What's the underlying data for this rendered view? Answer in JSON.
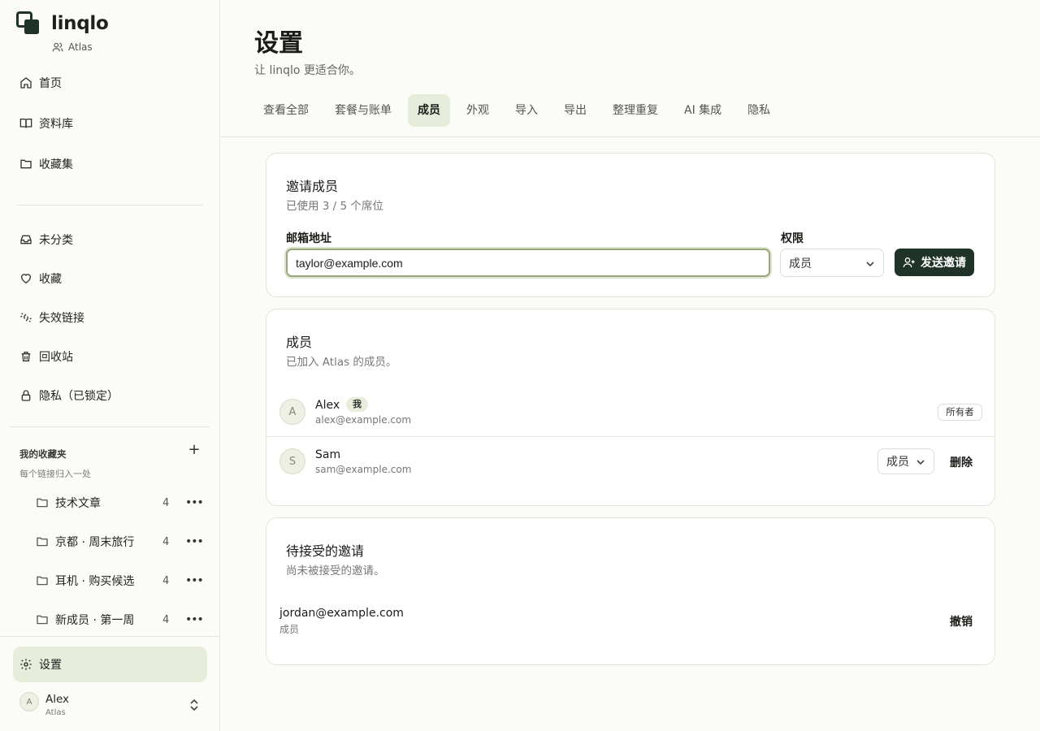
{
  "app": {
    "name": "linqlo",
    "workspace": "Atlas"
  },
  "sidebar": {
    "nav": [
      {
        "label": "首页",
        "icon": "home-icon"
      },
      {
        "label": "资料库",
        "icon": "book-icon"
      },
      {
        "label": "收藏集",
        "icon": "folder-icon"
      }
    ],
    "nav2": [
      {
        "label": "未分类",
        "icon": "inbox-icon"
      },
      {
        "label": "收藏",
        "icon": "heart-icon"
      },
      {
        "label": "失效链接",
        "icon": "broken-link-icon"
      },
      {
        "label": "回收站",
        "icon": "trash-icon"
      },
      {
        "label": "隐私（已锁定）",
        "icon": "lock-icon"
      }
    ],
    "favorites": {
      "title": "我的收藏夹",
      "subtitle": "每个链接归入一处",
      "add": "+",
      "folders": [
        {
          "label": "技术文章",
          "count": "4"
        },
        {
          "label": "京都 · 周末旅行",
          "count": "4"
        },
        {
          "label": "耳机 · 购买候选",
          "count": "4"
        },
        {
          "label": "新成员 · 第一周",
          "count": "4"
        }
      ],
      "more": "•••"
    },
    "settings": "设置",
    "user": {
      "initial": "A",
      "name": "Alex",
      "workspace": "Atlas"
    }
  },
  "main": {
    "title": "设置",
    "subtitle": "让 linqlo 更适合你。",
    "tabs": [
      "查看全部",
      "套餐与账单",
      "成员",
      "外观",
      "导入",
      "导出",
      "整理重复",
      "AI 集成",
      "隐私"
    ],
    "active_tab": "成员"
  },
  "invite": {
    "title": "邀请成员",
    "seats": "已使用 3 / 5 个席位",
    "email_label": "邮箱地址",
    "email_value": "taylor@example.com",
    "role_label": "权限",
    "role_value": "成员",
    "send_label": "发送邀请"
  },
  "members": {
    "title": "成员",
    "subtitle": "已加入 Atlas 的成员。",
    "rows": [
      {
        "initial": "A",
        "name": "Alex",
        "email": "alex@example.com",
        "badge": "我",
        "role": "所有者"
      },
      {
        "initial": "S",
        "name": "Sam",
        "email": "sam@example.com",
        "role": "成员",
        "action": "删除"
      }
    ]
  },
  "pending": {
    "title": "待接受的邀请",
    "subtitle": "尚未被接受的邀请。",
    "rows": [
      {
        "email": "jordan@example.com",
        "role": "成员",
        "action": "撤销"
      }
    ]
  }
}
